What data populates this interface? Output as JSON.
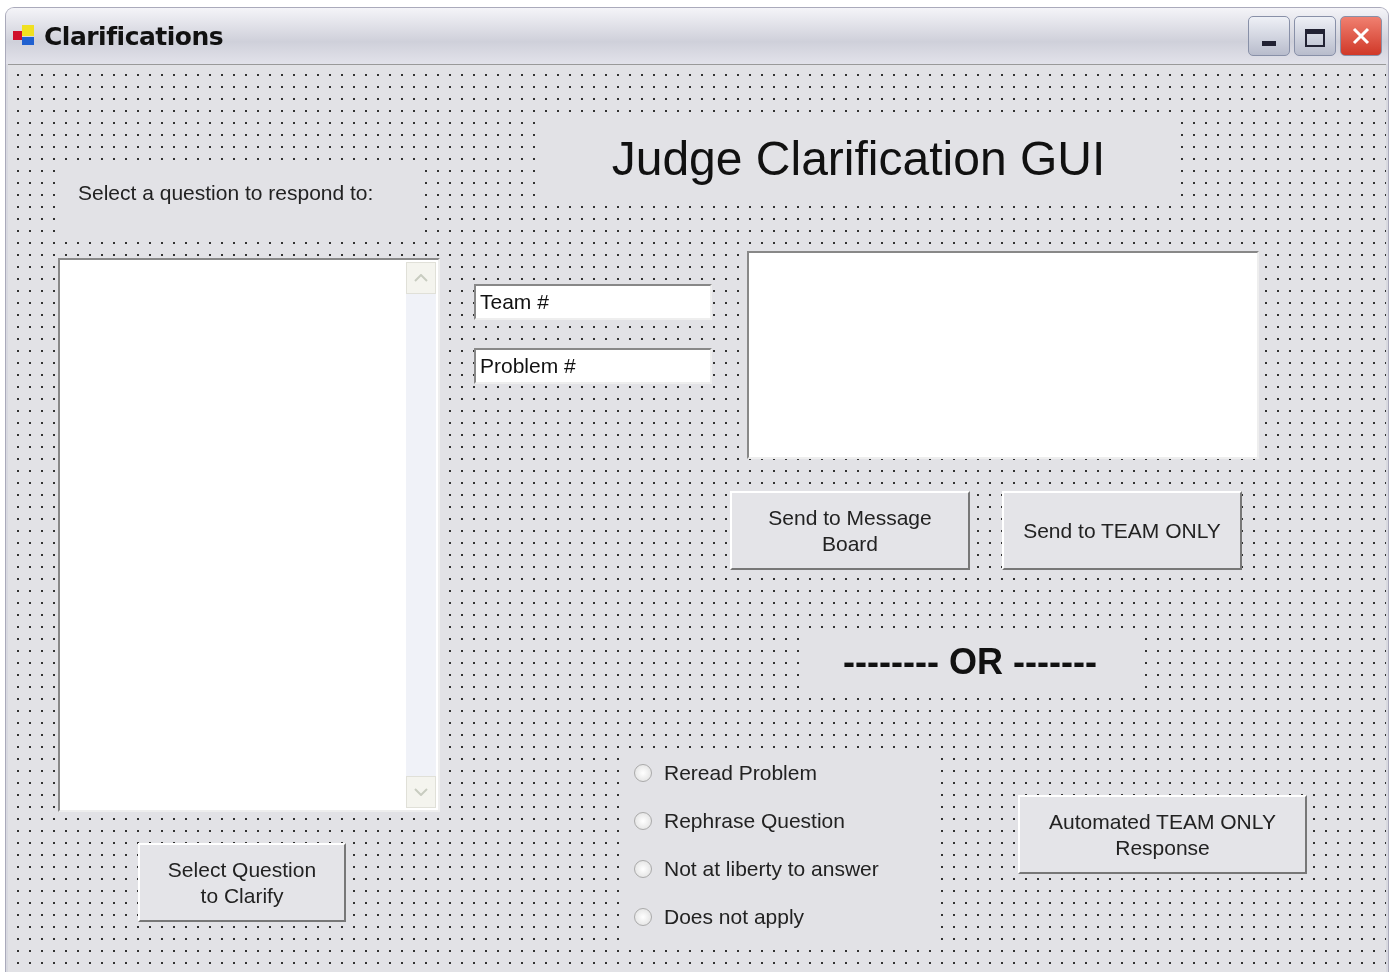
{
  "window": {
    "title": "Clarifications"
  },
  "heading": "Judge Clarification GUI",
  "question_prompt": "Select a question to respond to:",
  "team_field": {
    "value": "Team #"
  },
  "problem_field": {
    "value": "Problem #"
  },
  "buttons": {
    "message_board": "Send to Message Board",
    "team_only": "Send to TEAM ONLY",
    "select_question": "Select Question to Clarify",
    "automated": "Automated TEAM ONLY Response"
  },
  "separator": "-------- OR -------",
  "responses": [
    {
      "label": "Reread Problem",
      "selected": false
    },
    {
      "label": "Rephrase Question",
      "selected": false
    },
    {
      "label": "Not at liberty to answer",
      "selected": false
    },
    {
      "label": "Does not apply",
      "selected": false
    }
  ]
}
